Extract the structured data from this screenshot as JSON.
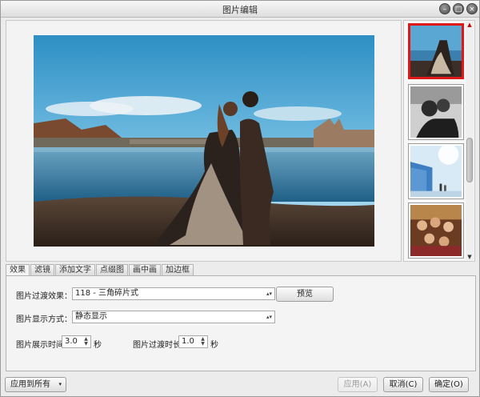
{
  "window": {
    "title": "图片编辑"
  },
  "tabs": [
    "效果",
    "滤镜",
    "添加文字",
    "点缀图",
    "画中画",
    "加边框"
  ],
  "effects": {
    "transition_label": "图片过渡效果：",
    "transition_value": "118 - 三角碎片式",
    "preview_button": "预览",
    "display_label": "图片显示方式：",
    "display_value": "静态显示",
    "show_time_label": "图片展示时间:",
    "show_time_value": "3.0",
    "show_time_unit": "秒",
    "transition_time_label": "图片过渡时长:",
    "transition_time_value": "1.0",
    "transition_time_unit": "秒"
  },
  "footer": {
    "apply_all": "应用到所有",
    "apply": "应用(A)",
    "cancel": "取消(C)",
    "ok": "确定(O)"
  },
  "colors": {
    "active_thumb_border": "#e01818"
  }
}
